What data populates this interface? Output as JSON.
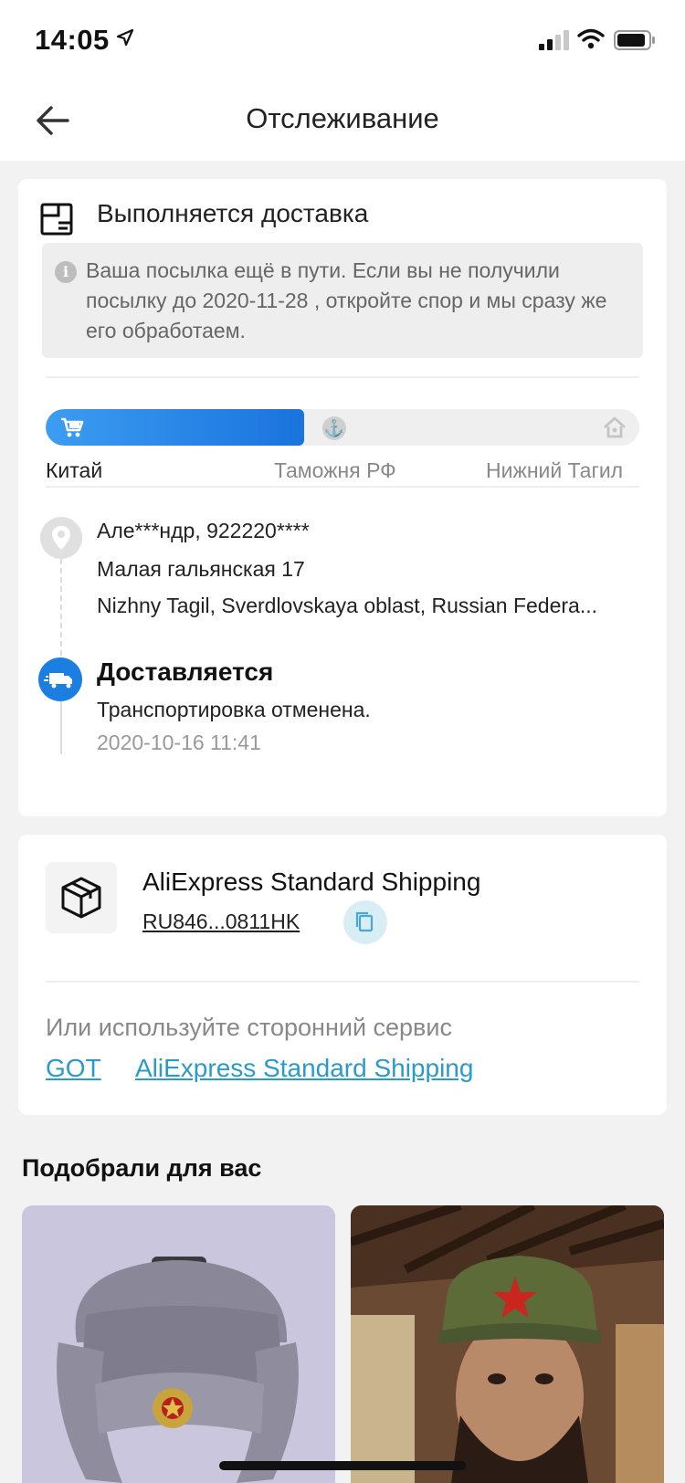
{
  "status_bar": {
    "time": "14:05"
  },
  "nav": {
    "title": "Отслеживание"
  },
  "status_card": {
    "title": "Выполняется доставка",
    "notice": "Ваша посылка ещё в пути. Если вы не получили посылку до 2020-11-28 , откройте спор и мы сразу же его обработаем.",
    "progress_fraction": 0.435,
    "stages": [
      "Китай",
      "Таможня РФ",
      "Нижний Тагил"
    ],
    "recipient": "Але***ндр, 922220****",
    "street": "Малая гальянская 17",
    "city": "Nizhny Tagil, Sverdlovskaya oblast, Russian Federa...",
    "event_title": "Доставляется",
    "event_desc": "Транспортировка отменена.",
    "event_date": "2020-10-16 11:41"
  },
  "shipping_card": {
    "carrier": "AliExpress Standard Shipping",
    "tracking_number": "RU846...0811HK",
    "alt_label": "Или используйте сторонний сервис",
    "alt_links": [
      "GOT",
      "AliExpress Standard Shipping"
    ]
  },
  "recommendations": {
    "title": "Подобрали для вас"
  },
  "colors": {
    "accent_blue": "#1a73de",
    "link": "#2a9bc8"
  }
}
